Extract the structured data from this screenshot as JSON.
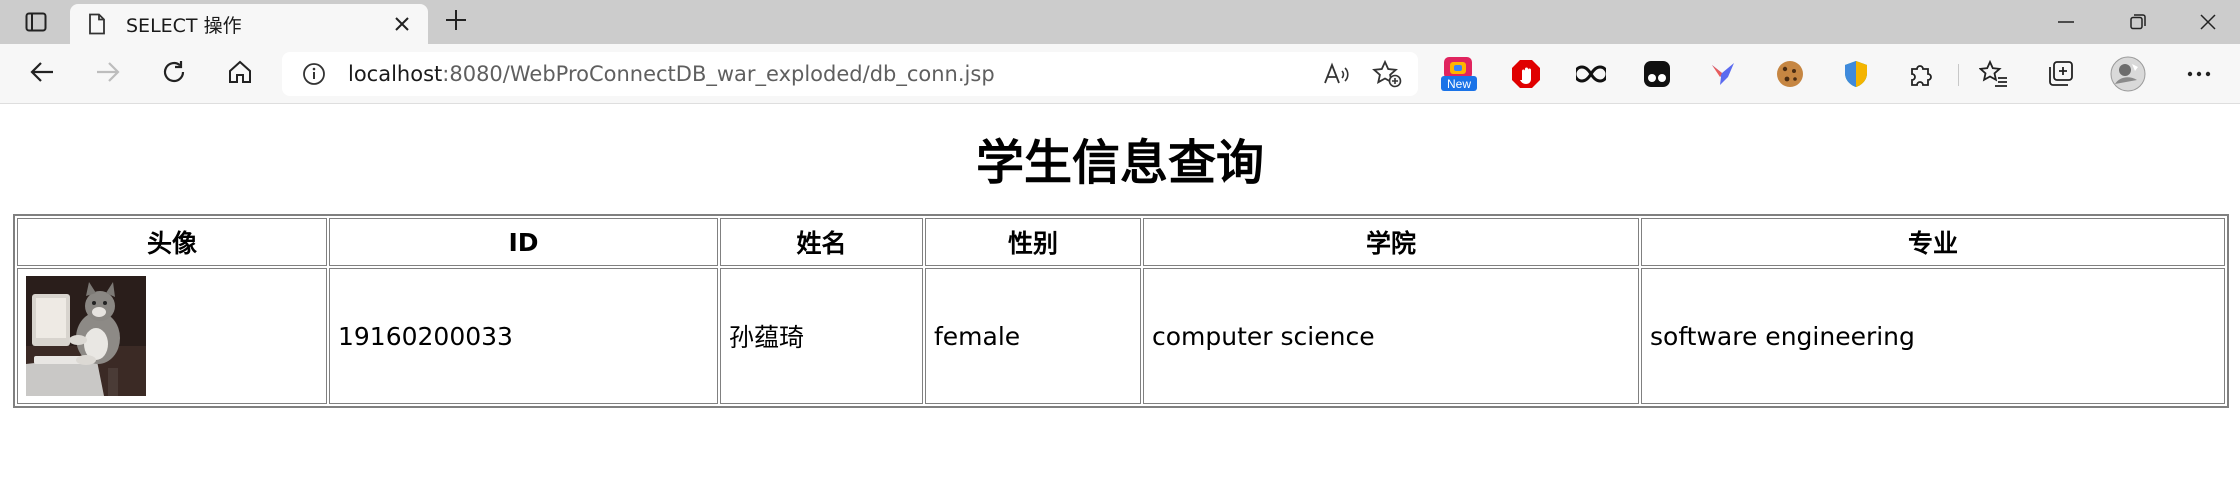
{
  "browser": {
    "tab_title": "SELECT 操作",
    "url_host": "localhost",
    "url_rest": ":8080/WebProConnectDB_war_exploded/db_conn.jsp",
    "new_badge": "New"
  },
  "page": {
    "heading": "学生信息查询",
    "table": {
      "headers": [
        "头像",
        "ID",
        "姓名",
        "性别",
        "学院",
        "专业"
      ],
      "rows": [
        {
          "avatar_desc": "kitten-photo",
          "id": "19160200033",
          "name": "孙蕴琦",
          "gender": "female",
          "college": "computer science",
          "major": "software engineering"
        }
      ]
    }
  },
  "icons": {
    "tab_actions": "tab-actions-icon",
    "page": "page-icon",
    "close": "close-icon",
    "new_tab": "plus-icon",
    "back": "back-arrow-icon",
    "forward": "forward-arrow-icon",
    "refresh": "refresh-icon",
    "home": "home-icon",
    "info": "info-icon",
    "read_aloud": "read-aloud-icon",
    "favorite_add": "star-add-icon",
    "favorites": "favorites-icon",
    "collections": "collections-icon",
    "profile": "profile-avatar",
    "more": "more-icon"
  }
}
